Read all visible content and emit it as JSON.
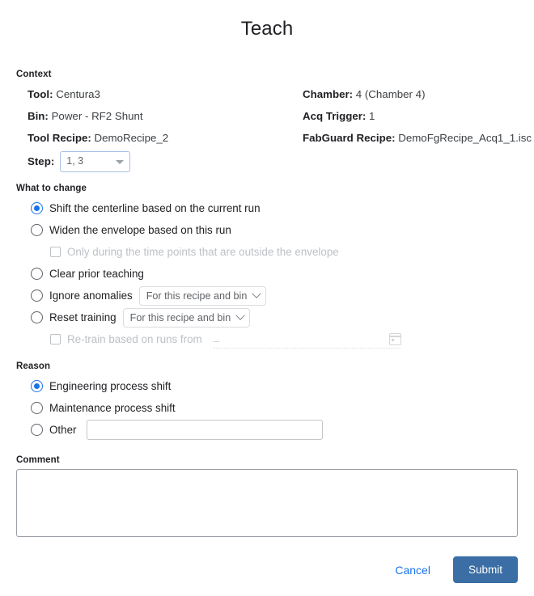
{
  "dialog": {
    "title": "Teach"
  },
  "context": {
    "label": "Context",
    "left": [
      {
        "key": "Tool:",
        "value": "Centura3"
      },
      {
        "key": "Bin:",
        "value": "Power - RF2 Shunt"
      },
      {
        "key": "Tool Recipe:",
        "value": "DemoRecipe_2"
      }
    ],
    "right": [
      {
        "key": "Chamber:",
        "value": "4 (Chamber 4)"
      },
      {
        "key": "Acq Trigger:",
        "value": "1"
      },
      {
        "key": "FabGuard Recipe:",
        "value": "DemoFgRecipe_Acq1_1.isc"
      }
    ],
    "step": {
      "key": "Step:",
      "value": "1, 3",
      "icon": "caret-down-icon"
    }
  },
  "what_to_change": {
    "label": "What to change",
    "options": [
      {
        "label": "Shift the centerline based on the current run",
        "selected": true
      },
      {
        "label": "Widen the envelope based on this run",
        "selected": false
      },
      {
        "label": "Clear prior teaching",
        "selected": false
      },
      {
        "label": "Ignore anomalies",
        "selected": false,
        "select_value": "For this recipe and bin"
      },
      {
        "label": "Reset training",
        "selected": false,
        "select_value": "For this recipe and bin"
      }
    ],
    "envelope_checkbox": {
      "label": "Only during the time points that are outside the envelope",
      "checked": false,
      "disabled": true
    },
    "retrain_checkbox": {
      "label": "Re-train based on runs from",
      "checked": false,
      "disabled": true,
      "date_value": "–",
      "icon": "calendar-icon"
    }
  },
  "reason": {
    "label": "Reason",
    "options": [
      {
        "label": "Engineering process shift",
        "selected": true
      },
      {
        "label": "Maintenance process shift",
        "selected": false
      },
      {
        "label": "Other",
        "selected": false
      }
    ],
    "other_value": "",
    "other_placeholder": ""
  },
  "comment": {
    "label": "Comment",
    "value": "",
    "placeholder": ""
  },
  "footer": {
    "cancel_label": "Cancel",
    "submit_label": "Submit"
  },
  "colors": {
    "accent_blue": "#1a73e8",
    "submit_blue": "#3a6ea5",
    "text": "#202124",
    "muted": "#bdc1c6",
    "border": "#dadce0"
  }
}
